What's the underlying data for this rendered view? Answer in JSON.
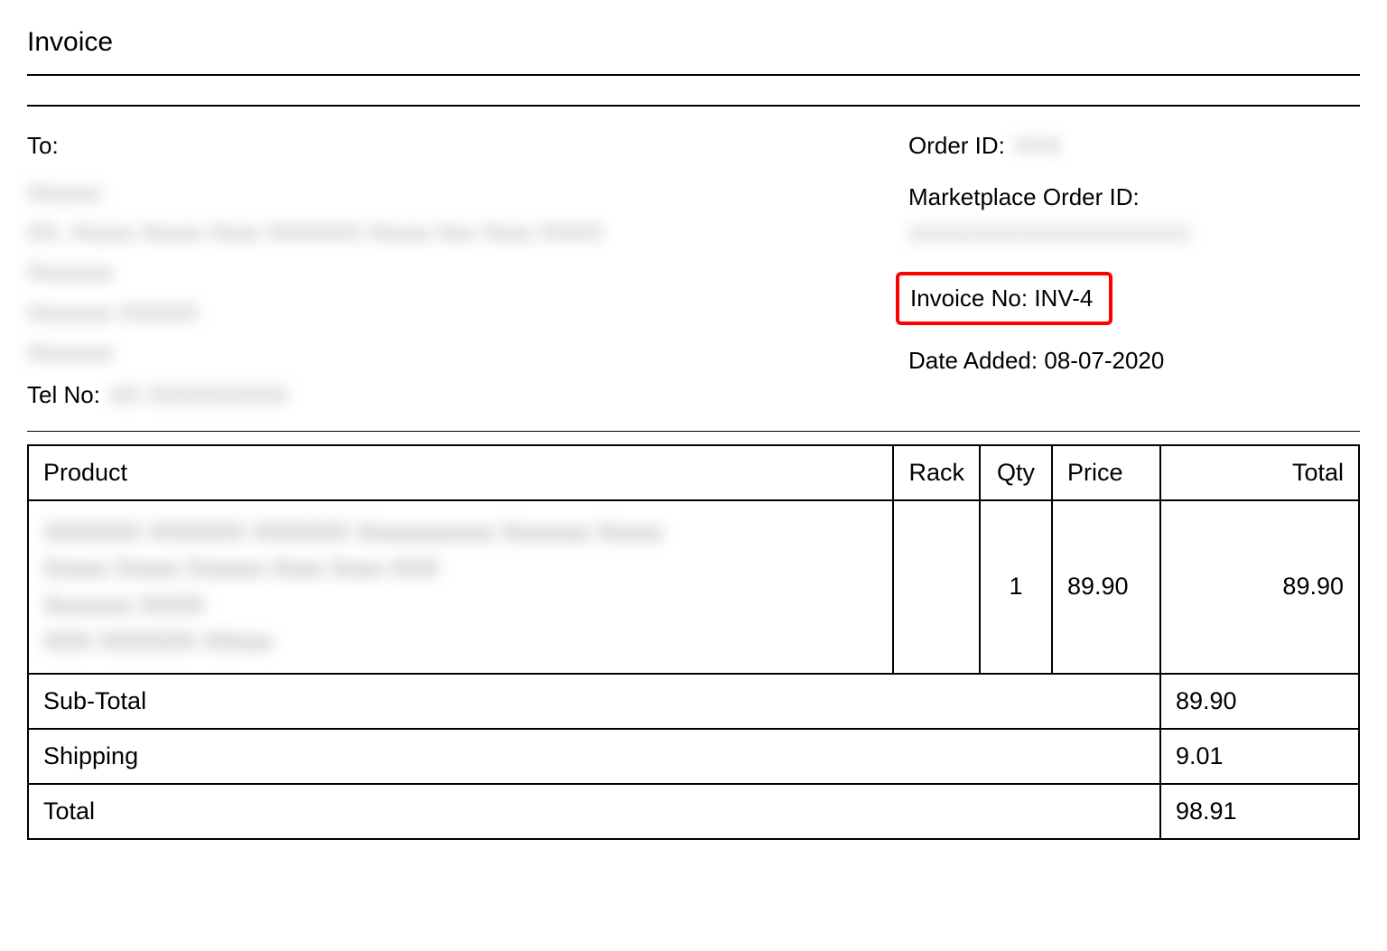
{
  "title": "Invoice",
  "to_label": "To:",
  "tel_label": "Tel No:",
  "order_id_label": "Order ID:",
  "marketplace_label": "Marketplace Order ID:",
  "invoice_no_label": "Invoice No:",
  "invoice_no_value": "INV-4",
  "date_added_label": "Date Added:",
  "date_added_value": "08-07-2020",
  "columns": {
    "product": "Product",
    "rack": "Rack",
    "qty": "Qty",
    "price": "Price",
    "total": "Total"
  },
  "line": {
    "qty": "1",
    "price": "89.90",
    "total": "89.90"
  },
  "summary": {
    "subtotal_label": "Sub-Total",
    "subtotal_value": "89.90",
    "shipping_label": "Shipping",
    "shipping_value": "9.01",
    "total_label": "Total",
    "total_value": "98.91"
  }
}
